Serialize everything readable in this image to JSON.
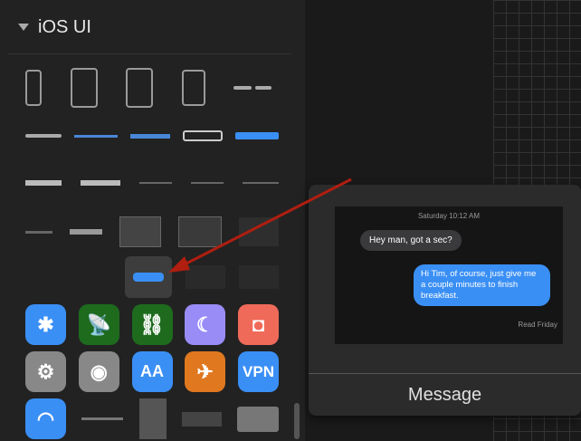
{
  "library": {
    "title": "iOS UI"
  },
  "preview": {
    "timestamp": "Saturday 10:12 AM",
    "incoming_message": "Hey man, got a sec?",
    "outgoing_message": "Hi Tim, of course, just give me a couple minutes to finish breakfast.",
    "read_status": "Read Friday"
  },
  "symbol": {
    "name": "Message"
  },
  "icons": {
    "row1": [
      "bluetooth-icon",
      "signal-tower-icon",
      "link-icon",
      "moon-icon",
      "notification-icon"
    ],
    "row2": [
      "settings-icon",
      "toggle-icon",
      "text-size-icon",
      "airplane-icon",
      "vpn-icon"
    ],
    "vpn_label": "VPN",
    "text_size_label": "AA"
  },
  "colors": {
    "accent": "#3a8ff5",
    "arrow": "#b01e10",
    "grid": "#333333"
  }
}
